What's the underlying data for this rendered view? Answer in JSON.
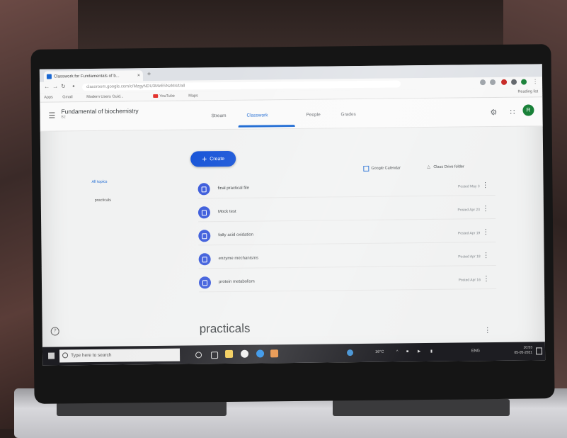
{
  "browser": {
    "tab_title": "Classwork for Fundamentals of b...",
    "tab_close": "×",
    "new_tab": "+",
    "url": "classroom.google.com/c/MzgyNDU3MzE5NzM4/t/all",
    "bookmarks": [
      "Apps",
      "Gmail",
      "Modern Users Guid...",
      "YouTube",
      "Maps"
    ],
    "reading_list": "Reading list"
  },
  "header": {
    "class_title": "Fundamental of biochemistry",
    "class_sub": "B2",
    "tabs": [
      "Stream",
      "Classwork",
      "People",
      "Grades"
    ],
    "active_tab": "Classwork",
    "avatar_initial": "R",
    "colors": {
      "accent": "#1967d2",
      "avatar": "#188038"
    }
  },
  "toolbar": {
    "create_label": "Create",
    "calendar_label": "Google Calendar",
    "drive_label": "Class Drive folder"
  },
  "sidebar": {
    "topics": [
      "All topics",
      "practicals"
    ]
  },
  "classwork_items": [
    {
      "title": "final practical file",
      "date": "Posted May 3"
    },
    {
      "title": "Mock test",
      "date": "Posted Apr 23"
    },
    {
      "title": "fatty acid oxidation",
      "date": "Posted Apr 19"
    },
    {
      "title": "enzyme mechanisms",
      "date": "Posted Apr 18"
    },
    {
      "title": "protein metabolism",
      "date": "Posted Apr 16"
    }
  ],
  "section": {
    "title": "practicals"
  },
  "taskbar": {
    "search_placeholder": "Type here to search",
    "weather": "16°C",
    "lang": "ENG",
    "time": "10:53",
    "date": "05-05-2021"
  }
}
